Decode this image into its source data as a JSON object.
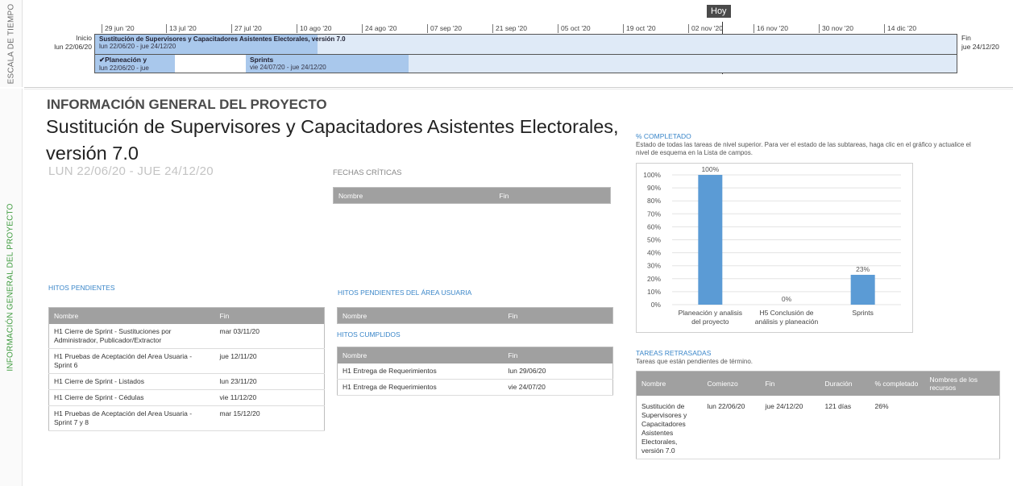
{
  "side": {
    "timeline_label": "ESCALA DE TIEMPO",
    "info_label": "INFORMACIÓN GENERAL DEL PROYECTO"
  },
  "timeline": {
    "ticks": [
      "29 jun '20",
      "13 jul '20",
      "27 jul '20",
      "10 ago '20",
      "24 ago '20",
      "07 sep '20",
      "21 sep '20",
      "05 oct '20",
      "19 oct '20",
      "02 nov '20",
      "16 nov '20",
      "30 nov '20",
      "14 dic '20"
    ],
    "today_label": "Hoy",
    "start_label": "Inicio",
    "start_date": "lun 22/06/20",
    "end_label": "Fin",
    "end_date": "jue 24/12/20",
    "project_bar": {
      "title": "Sustitución de Supervisores y Capacitadores Asistentes Electorales, versión 7.0",
      "dates": "lun 22/06/20 - jue 24/12/20"
    },
    "plan_bar": {
      "title": "✔Planeación y",
      "dates": "lun 22/06/20 - jue"
    },
    "sprints_bar": {
      "title": "Sprints",
      "dates": "vie 24/07/20 - jue 24/12/20"
    }
  },
  "main": {
    "section_title": "INFORMACIÓN GENERAL DEL PROYECTO",
    "project_name": "Sustitución de Supervisores y Capacitadores Asistentes Electorales, versión 7.0",
    "project_dates": "LUN 22/06/20 - JUE 24/12/20"
  },
  "critical_dates": {
    "heading": "FECHAS CRÍTICAS",
    "columns": [
      "Nombre",
      "Fin"
    ]
  },
  "pending_milestones": {
    "heading": "HITOS PENDIENTES",
    "columns": [
      "Nombre",
      "Fin"
    ],
    "rows": [
      [
        "H1 Cierre de Sprint - Sustituciones por Administrador, Publicador/Extractor",
        "mar 03/11/20"
      ],
      [
        "H1 Pruebas de Aceptación del Area Usuaria - Sprint 6",
        "jue 12/11/20"
      ],
      [
        "H1 Cierre de Sprint - Listados",
        "lun 23/11/20"
      ],
      [
        "H1 Cierre de Sprint -  Cédulas",
        "vie 11/12/20"
      ],
      [
        "H1 Pruebas de Aceptación del Area Usuaria - Sprint 7 y 8",
        "mar 15/12/20"
      ]
    ]
  },
  "user_area_milestones": {
    "heading": "HITOS PENDIENTES DEL ÁREA USUARIA",
    "columns": [
      "Nombre",
      "Fin"
    ]
  },
  "completed_milestones": {
    "heading": "HITOS CUMPLIDOS",
    "columns": [
      "Nombre",
      "Fin"
    ],
    "rows": [
      [
        "H1 Entrega de Requerimientos",
        "lun 29/06/20"
      ],
      [
        "H1 Entrega de Requerimientos",
        "vie 24/07/20"
      ]
    ]
  },
  "percent_complete": {
    "heading": "% COMPLETADO",
    "description": "Estado de todas las tareas de nivel superior. Para ver el estado de las subtareas, haga clic en el gráfico y actualice el nivel de esquema en la Lista de campos."
  },
  "chart_data": {
    "type": "bar",
    "categories": [
      "Planeación y analisis del proyecto",
      "H5 Conclusión de análisis y planeación",
      "Sprints"
    ],
    "values": [
      100,
      0,
      23
    ],
    "data_labels": [
      "100%",
      "0%",
      "23%"
    ],
    "yticks": [
      "0%",
      "10%",
      "20%",
      "30%",
      "40%",
      "50%",
      "60%",
      "70%",
      "80%",
      "90%",
      "100%"
    ],
    "ylim": [
      0,
      100
    ],
    "grid": true,
    "bar_color": "#5b9bd5"
  },
  "late_tasks": {
    "heading": "TAREAS RETRASADAS",
    "description": "Tareas que están pendientes de término.",
    "columns": [
      "Nombre",
      "Comienzo",
      "Fin",
      "Duración",
      "% completado",
      "Nombres de los recursos"
    ],
    "rows": [
      [
        "Sustitución de Supervisores y Capacitadores Asistentes Electorales, versión 7.0",
        "lun 22/06/20",
        "jue 24/12/20",
        "121 días",
        "26%",
        ""
      ]
    ]
  }
}
